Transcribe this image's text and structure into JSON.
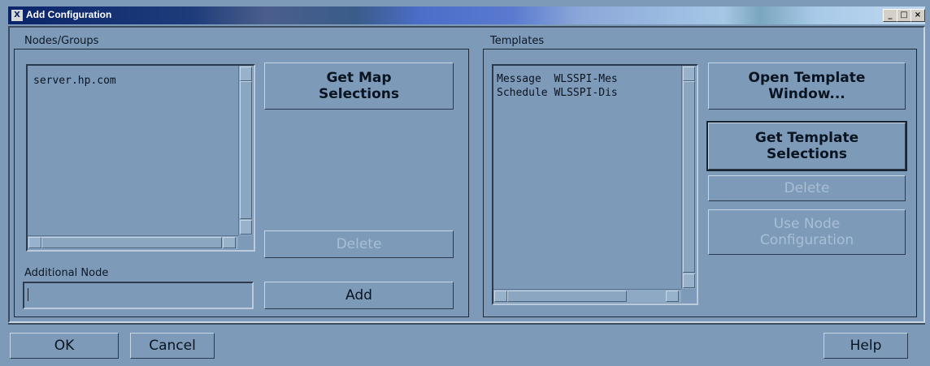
{
  "window": {
    "title": "Add Configuration",
    "icon_name": "x-app-icon",
    "controls": {
      "minimize": "_",
      "maximize": "□",
      "close": "×"
    }
  },
  "nodes_groups": {
    "label": "Nodes/Groups",
    "items": [
      "server.hp.com"
    ],
    "get_map_selections_label": "Get Map\nSelections",
    "delete_label": "Delete",
    "additional_node_label": "Additional Node",
    "additional_node_value": "",
    "add_label": "Add"
  },
  "templates": {
    "label": "Templates",
    "items": [
      {
        "type": "Message",
        "name": "WLSSPI-Mes"
      },
      {
        "type": "Schedule",
        "name": "WLSSPI-Dis"
      }
    ],
    "open_template_window_label": "Open Template\nWindow...",
    "get_template_selections_label": "Get Template\nSelections",
    "delete_label": "Delete",
    "use_node_configuration_label": "Use Node\nConfiguration"
  },
  "footer": {
    "ok_label": "OK",
    "cancel_label": "Cancel",
    "help_label": "Help"
  },
  "colors": {
    "background": "#7d9ab8",
    "text": "#0a1420",
    "disabled_text": "#a9bfd4",
    "title_bar": "#0a246a"
  }
}
